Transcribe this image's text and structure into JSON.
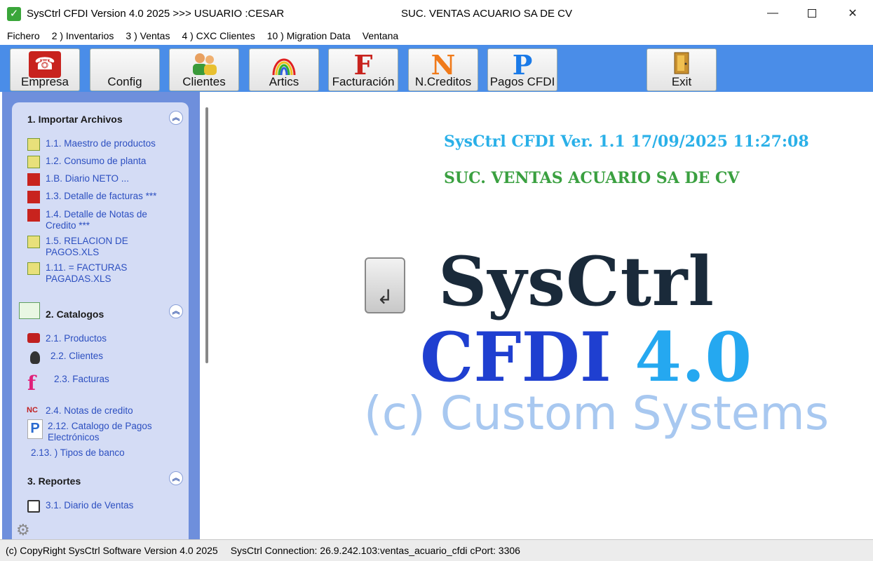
{
  "window": {
    "title": "SysCtrl CFDI Version 4.0 2025 >>> USUARIO :CESAR",
    "company": "SUC. VENTAS ACUARIO SA DE CV",
    "min_glyph": "—",
    "close_glyph": "✕"
  },
  "menu": [
    "Fichero",
    "2 ) Inventarios",
    "3 ) Ventas",
    "4 ) CXC Clientes",
    "10 ) Migration Data",
    "Ventana"
  ],
  "toolbar": {
    "empresa": "Empresa",
    "config": "Config",
    "clientes": "Clientes",
    "artics": "Artics",
    "facturacion": "Facturación",
    "ncreditos": "N.Creditos",
    "pagos": "Pagos CFDI",
    "exit": "Exit",
    "letters": {
      "facturacion": "F",
      "ncreditos": "N",
      "pagos": "P"
    }
  },
  "sidebar": {
    "sections": [
      {
        "title": "1. Importar Archivos",
        "items": [
          "1.1. Maestro de productos",
          "1.2. Consumo de planta",
          "1.B. Diario NETO ...",
          "1.3. Detalle de facturas ***",
          "1.4. Detalle de Notas de Credito ***",
          "1.5. RELACION DE PAGOS.XLS",
          "1.11. = FACTURAS PAGADAS.XLS"
        ]
      },
      {
        "title": "2. Catalogos",
        "items": [
          "2.1. Productos",
          "2.2. Clientes",
          "2.3. Facturas",
          "2.4. Notas de credito",
          "2.12. Catalogo de Pagos Electrónicos",
          "2.13. ) Tipos de banco"
        ]
      },
      {
        "title": "3. Reportes",
        "items": [
          "3.1. Diario de Ventas"
        ]
      }
    ],
    "collapse_glyph": "︽",
    "icon_letters": {
      "facturas": "f",
      "notas": "NC",
      "pagos": "P"
    }
  },
  "main": {
    "version_line": "SysCtrl CFDI Ver. 1.1 17/09/2025 11:27:08",
    "company_line": "SUC. VENTAS ACUARIO SA DE CV",
    "logo_line1": "SysCtrl",
    "logo_cfdi": "CFDI ",
    "logo_ver": "4.0",
    "logo_line3": "(c) Custom Systems",
    "enter_glyph": "↲"
  },
  "status": {
    "copyright": "(c) CopyRight SysCtrl Software Version 4.0 2025",
    "connection": "SysCtrl Connection: 26.9.242.103:ventas_acuario_cfdi cPort: 3306"
  }
}
